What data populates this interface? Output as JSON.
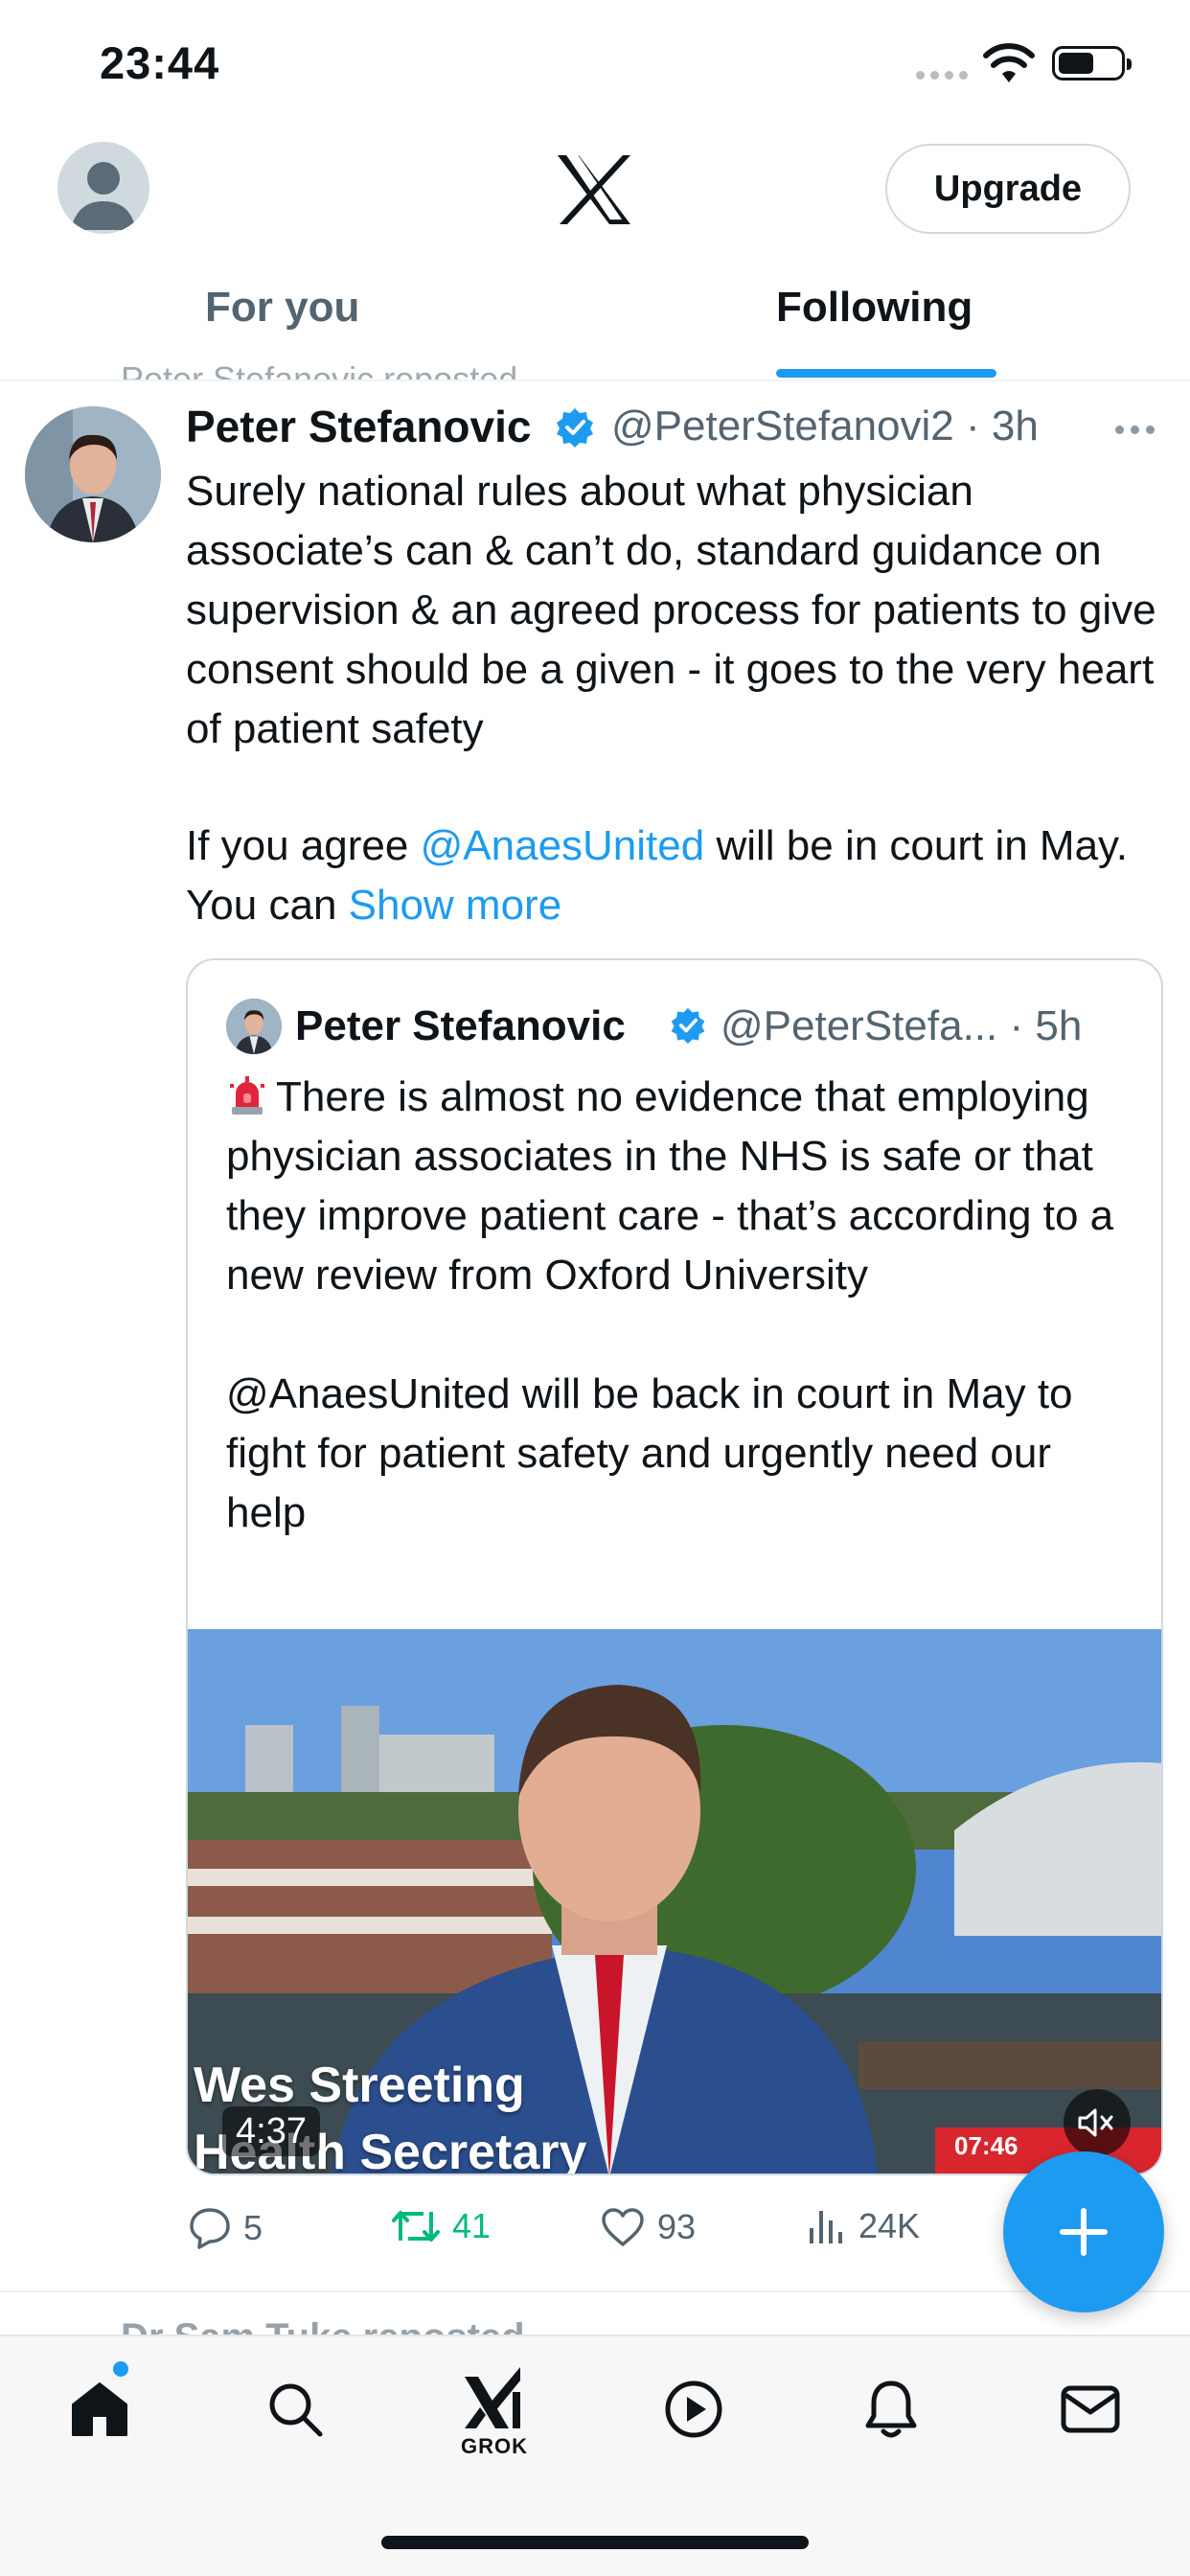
{
  "status_bar": {
    "time": "23:44"
  },
  "header": {
    "upgrade_label": "Upgrade",
    "tabs": [
      {
        "label": "For you",
        "selected": false
      },
      {
        "label": "Following",
        "selected": true
      }
    ]
  },
  "tweet": {
    "repost_context": "Peter Stefanovic reposted",
    "author_name": "Peter Stefanovic",
    "author_handle": "@PeterStefanovi2",
    "time_ago": "3h",
    "text": "Surely national rules about what physician associate’s can & can’t do, standard guidance on supervision & an agreed process for patients to give consent should be a given - it goes to the very heart of patient safety",
    "text2_prefix": "If you agree ",
    "text2_mention": "@AnaesUnited",
    "text2_middle": " will be in court in May. You can ",
    "show_more": "Show more",
    "quote": {
      "author_name": "Peter Stefanovic",
      "author_handle": "@PeterStefa...",
      "time_ago": "5h",
      "text": "There is almost no evidence that employing physician associates in the NHS is safe or that they improve patient care - that’s according to a new review from Oxford University\n\n@AnaesUnited will be back in court in May to fight for patient safety and urgently need our help",
      "media": {
        "caption_line1": "Wes Streeting",
        "caption_line2": "Health Secretary",
        "duration": "4:37",
        "clock": "07:46"
      }
    },
    "actions": {
      "replies": "5",
      "retweets": "41",
      "likes": "93",
      "views": "24K"
    }
  },
  "next_tweet_context": "Dr Sam Tuke reposted",
  "bottom_nav": {
    "items": [
      "home",
      "search",
      "grok",
      "video",
      "notifications",
      "messages"
    ],
    "grok_label": "GROK"
  },
  "colors": {
    "accent": "#1d9bf0",
    "retweet_green": "#00ba7c",
    "secondary_text": "#536471"
  }
}
